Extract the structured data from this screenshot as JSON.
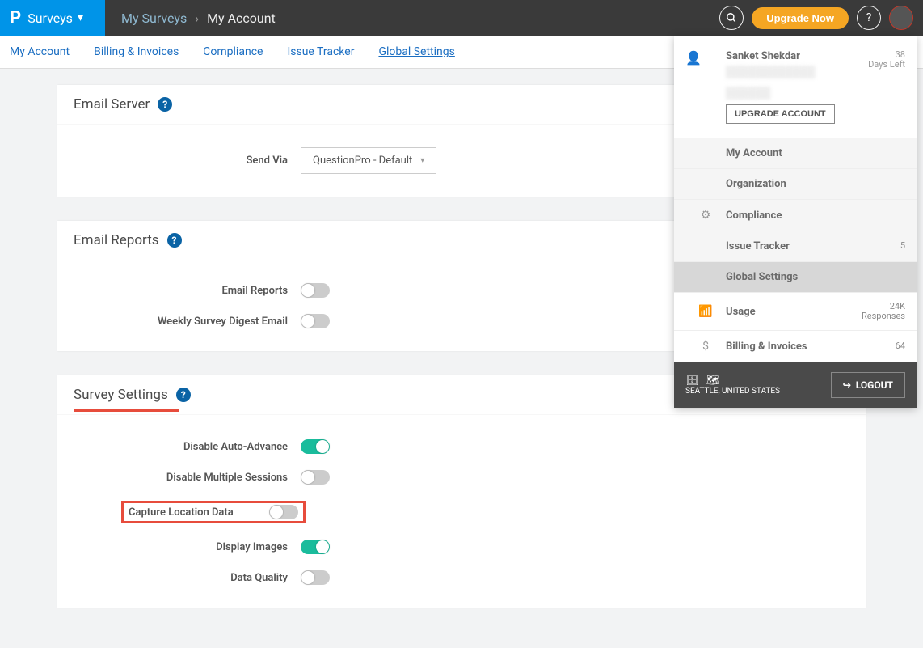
{
  "header": {
    "brand": "Surveys",
    "breadcrumb_parent": "My Surveys",
    "breadcrumb_current": "My Account",
    "upgrade": "Upgrade Now"
  },
  "subnav": {
    "items": [
      "My Account",
      "Billing & Invoices",
      "Compliance",
      "Issue Tracker",
      "Global Settings"
    ],
    "active_index": 4
  },
  "panels": {
    "emailServer": {
      "title": "Email Server",
      "sendVia": {
        "label": "Send Via",
        "value": "QuestionPro - Default"
      }
    },
    "emailReports": {
      "title": "Email Reports",
      "rows": [
        {
          "label": "Email Reports",
          "on": false
        },
        {
          "label": "Weekly Survey Digest Email",
          "on": false
        }
      ]
    },
    "surveySettings": {
      "title": "Survey Settings",
      "rows": [
        {
          "label": "Disable Auto-Advance",
          "on": true,
          "highlight": false
        },
        {
          "label": "Disable Multiple Sessions",
          "on": false,
          "highlight": false
        },
        {
          "label": "Capture Location Data",
          "on": false,
          "highlight": true
        },
        {
          "label": "Display Images",
          "on": true,
          "highlight": false
        },
        {
          "label": "Data Quality",
          "on": false,
          "highlight": false
        }
      ]
    }
  },
  "profile": {
    "name": "Sanket Shekdar",
    "days": "38",
    "days_label": "Days Left",
    "upgrade_account": "UPGRADE ACCOUNT",
    "menu": [
      {
        "label": "My Account",
        "icon": ""
      },
      {
        "label": "Organization",
        "icon": ""
      },
      {
        "label": "Compliance",
        "icon": "⚙"
      },
      {
        "label": "Issue Tracker",
        "icon": "",
        "value": "5"
      },
      {
        "label": "Global Settings",
        "icon": "",
        "selected": true
      },
      {
        "label": "Usage",
        "icon": "📶",
        "value": "24K",
        "sub": "Responses"
      },
      {
        "label": "Billing & Invoices",
        "icon": "$",
        "value": "64"
      }
    ],
    "location": "SEATTLE, UNITED STATES",
    "logout": "LOGOUT"
  }
}
